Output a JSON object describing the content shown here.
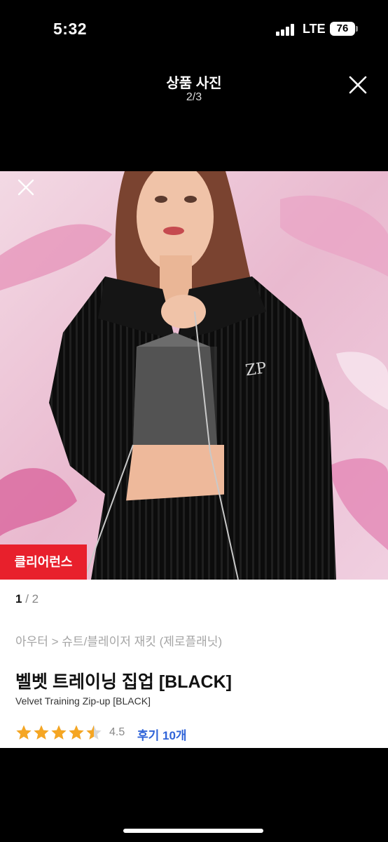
{
  "status_bar": {
    "time": "5:32",
    "network": "LTE",
    "battery": "76"
  },
  "viewer": {
    "title": "상품 사진",
    "counter": "2/3"
  },
  "product": {
    "badge": "클리어런스",
    "pager_current": "1",
    "pager_sep": " / ",
    "pager_total": "2",
    "breadcrumb": "아우터 > 슈트/블레이저 재킷 (제로플래닛)",
    "name": "벨벳 트레이닝 집업 [BLACK]",
    "name_en": "Velvet Training Zip-up [BLACK]",
    "rating": "4.5",
    "rating_value": 4.5,
    "rating_max": 5,
    "review_link": "후기 10개"
  },
  "colors": {
    "star": "#f5a623",
    "badge": "#e8202c",
    "link": "#2f63d8"
  }
}
